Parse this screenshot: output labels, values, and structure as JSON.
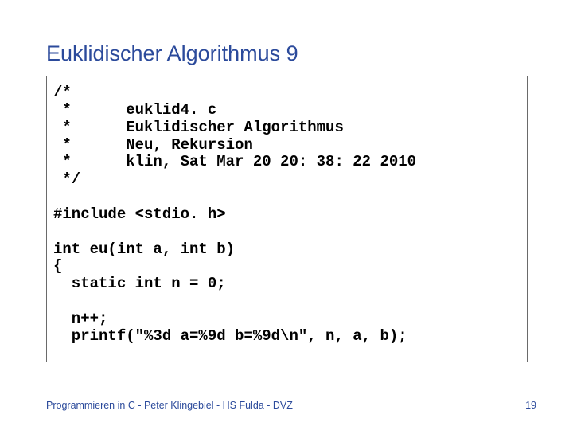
{
  "title": "Euklidischer Algorithmus 9",
  "code_lines": [
    "/*",
    " *      euklid4. c",
    " *      Euklidischer Algorithmus",
    " *      Neu, Rekursion",
    " *      klin, Sat Mar 20 20: 38: 22 2010",
    " */",
    "",
    "#include <stdio. h>",
    "",
    "int eu(int a, int b)",
    "{",
    "  static int n = 0;",
    "",
    "  n++;",
    "  printf(\"%3d a=%9d b=%9d\\n\", n, a, b);"
  ],
  "footer": "Programmieren in C - Peter Klingebiel - HS Fulda - DVZ",
  "page_number": "19"
}
